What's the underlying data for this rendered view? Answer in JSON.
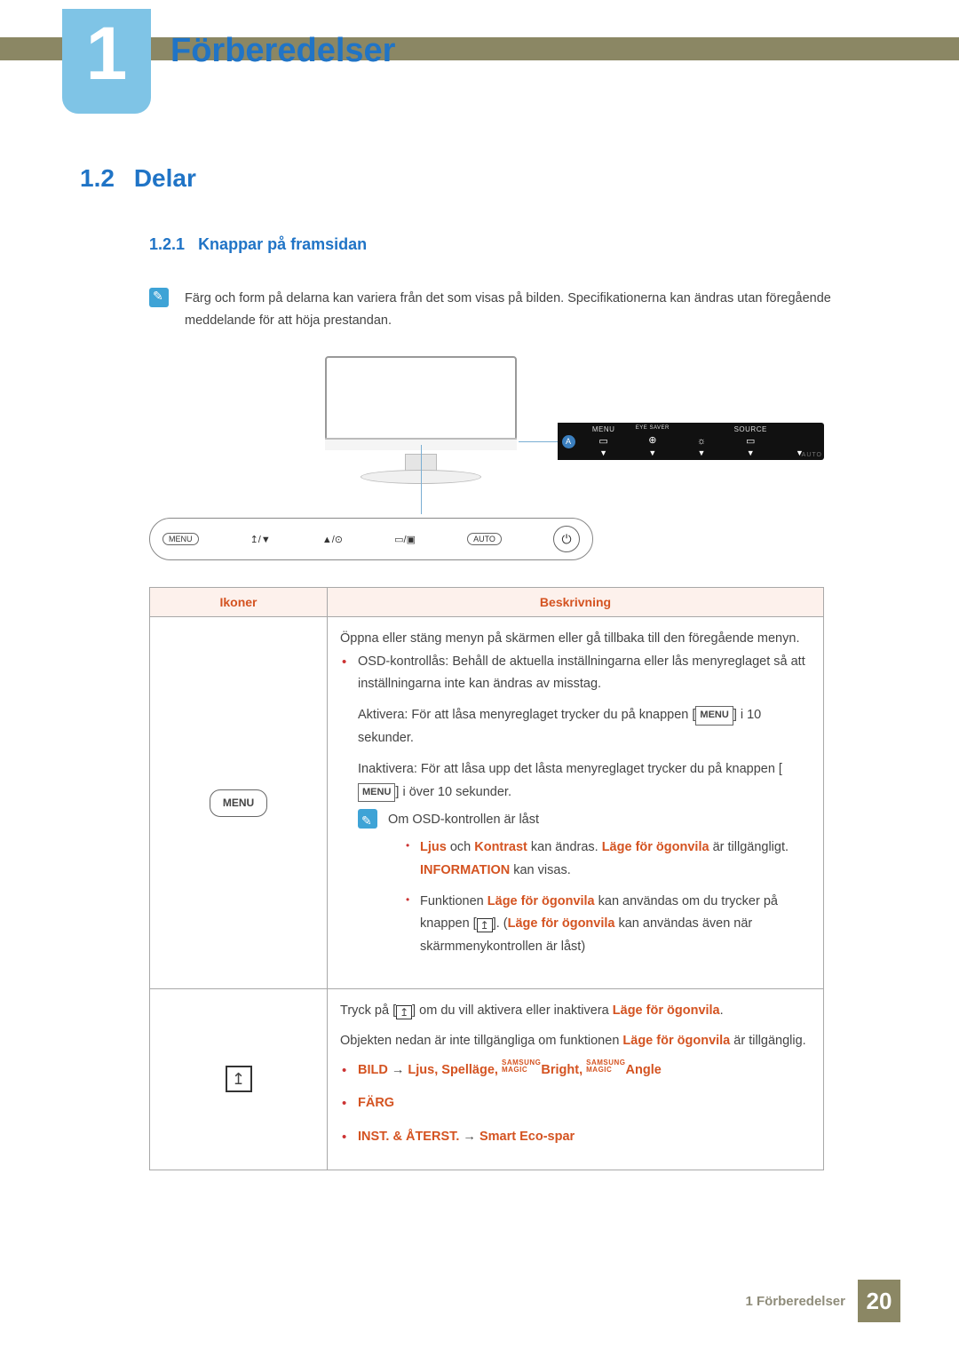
{
  "chapter": {
    "number": "1",
    "title": "Förberedelser"
  },
  "section": {
    "number": "1.2",
    "title": "Delar"
  },
  "subsection": {
    "number": "1.2.1",
    "title": "Knappar på framsidan"
  },
  "note_top": "Färg och form på delarna kan variera från det som visas på bilden. Specifikationerna kan ändras utan föregående meddelande för att höja prestandan.",
  "osd": {
    "badge": "A",
    "cells": [
      {
        "label": "MENU",
        "glyph": "▭"
      },
      {
        "label": "EYE SAVER",
        "glyph": "⊕"
      },
      {
        "label": "",
        "glyph": "☼"
      },
      {
        "label": "SOURCE",
        "glyph": "▭"
      },
      {
        "label": "",
        "glyph": ""
      }
    ],
    "auto": "AUTO",
    "triangle": "▼"
  },
  "button_bar": {
    "menu": "MENU",
    "eye": "↥/▼",
    "bright": "▲/⊙",
    "source": "▭/▣",
    "auto": "AUTO",
    "power": "⏻"
  },
  "table": {
    "headers": {
      "icons": "Ikoner",
      "desc": "Beskrivning"
    },
    "row1": {
      "icon_label": "MENU",
      "p1": "Öppna eller stäng menyn på skärmen eller gå tillbaka till den föregående menyn.",
      "li1_a": "OSD-kontrollås: Behåll de aktuella inställningarna eller lås menyreglaget så att inställningarna inte kan ändras av misstag.",
      "li1_b_pre": "Aktivera: För att låsa menyreglaget trycker du på knappen [",
      "li1_b_btn": "MENU",
      "li1_b_post": "] i 10 sekunder.",
      "li1_c_pre": "Inaktivera: För att låsa upp det låsta menyreglaget trycker du på knappen [",
      "li1_c_btn": "MENU",
      "li1_c_post": "] i över 10 sekunder.",
      "note_head": "Om OSD-kontrollen är låst",
      "note_li1_a": "Ljus",
      "note_li1_b": " och ",
      "note_li1_c": "Kontrast",
      "note_li1_d": " kan ändras. ",
      "note_li1_e": "Läge för ögonvila",
      "note_li1_f": " är tillgängligt. ",
      "note_li1_g": "INFORMATION",
      "note_li1_h": " kan visas.",
      "note_li2_a": "Funktionen ",
      "note_li2_b": "Läge för ögonvila",
      "note_li2_c": " kan användas om du trycker på knappen [",
      "note_li2_d": "]. (",
      "note_li2_e": "Läge för ögonvila",
      "note_li2_f": " kan användas även när skärmmenykontrollen är låst)"
    },
    "row2": {
      "p1_a": "Tryck på [",
      "p1_b": "] om du vill aktivera eller inaktivera ",
      "p1_c": "Läge för ögonvila",
      "p1_d": ".",
      "p2_a": "Objekten nedan är inte tillgängliga om funktionen ",
      "p2_b": "Läge för ögonvila",
      "p2_c": " är tillgänglig.",
      "li1_a": "BILD",
      "li1_arrow": " → ",
      "li1_b": "Ljus",
      "li1_c": ", ",
      "li1_d": "Spelläge",
      "li1_e": ", ",
      "li1_magic1_top": "SAMSUNG",
      "li1_magic1_bot": "MAGIC",
      "li1_f": "Bright",
      "li1_g": ", ",
      "li1_magic2_top": "SAMSUNG",
      "li1_magic2_bot": "MAGIC",
      "li1_h": "Angle",
      "li2": "FÄRG",
      "li3_a": "INST. & ÅTERST.",
      "li3_b": " → ",
      "li3_c": "Smart Eco-spar"
    }
  },
  "footer": {
    "text": "1 Förberedelser",
    "page": "20"
  }
}
